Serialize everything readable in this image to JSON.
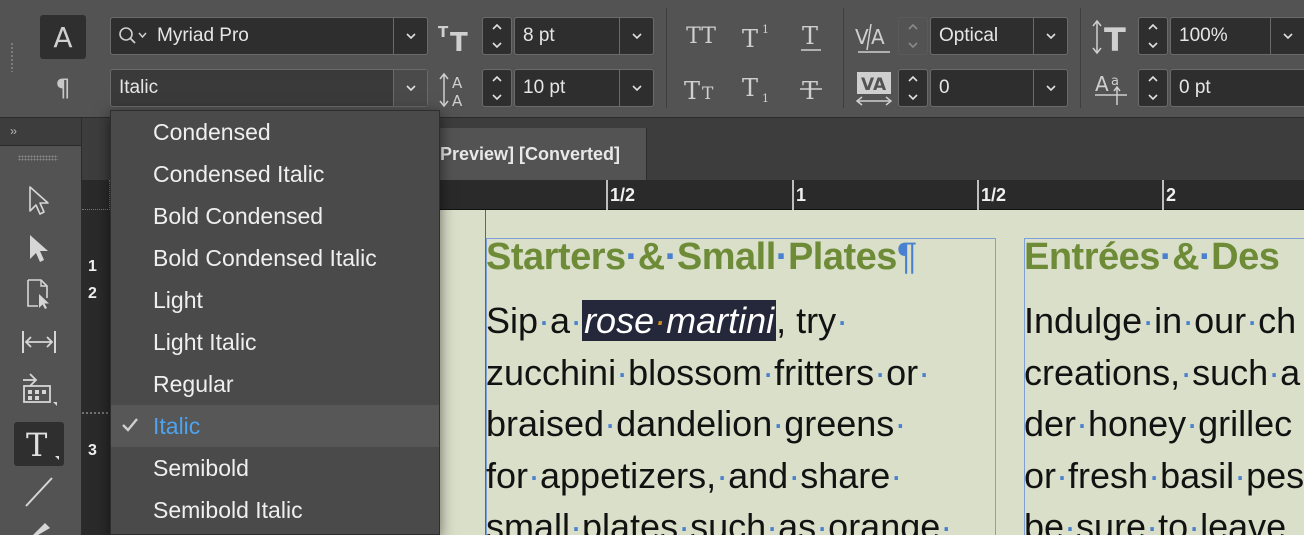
{
  "control_bar": {
    "character_mode_icon": "A",
    "paragraph_mode_icon": "¶",
    "font_family": "Myriad Pro",
    "font_style": "Italic",
    "font_size": "8 pt",
    "leading": "10 pt",
    "kerning": "Optical",
    "tracking": "0",
    "vertical_scale": "100%",
    "baseline_shift": "0 pt"
  },
  "tab": {
    "title": "Preview] [Converted]"
  },
  "ruler": {
    "h_labels": [
      "1/2",
      "1",
      "1/2",
      "2"
    ],
    "v_labels": [
      "1",
      "2",
      "3"
    ]
  },
  "font_style_menu": {
    "items": [
      "Condensed",
      "Condensed Italic",
      "Bold Condensed",
      "Bold Condensed Italic",
      "Light",
      "Light Italic",
      "Regular",
      "Italic",
      "Semibold",
      "Semibold Italic"
    ],
    "selected": "Italic"
  },
  "document": {
    "col1_heading": [
      "Starters",
      "&",
      "Small",
      "Plates"
    ],
    "col1_lines": [
      {
        "pre": "Sip",
        "mid": "a",
        "sel": [
          "rose",
          "martini"
        ],
        "post": ", try"
      },
      {
        "words": [
          "zucchini",
          "blossom",
          "fritters",
          "or"
        ]
      },
      {
        "words": [
          "braised",
          "dandelion",
          "greens"
        ]
      },
      {
        "words": [
          "for",
          "appetizers,",
          "and",
          "share"
        ]
      },
      {
        "words": [
          "small",
          "plates",
          "such",
          "as",
          "orange"
        ]
      }
    ],
    "col2_heading": [
      "Entrées",
      "&",
      "Des"
    ],
    "col2_lines": [
      {
        "words": [
          "Indulge",
          "in",
          "our",
          "ch"
        ]
      },
      {
        "words": [
          "creations,",
          "such",
          "a"
        ]
      },
      {
        "words": [
          "der",
          "honey",
          "grillec"
        ]
      },
      {
        "words": [
          "or",
          "fresh",
          "basil",
          "pes"
        ]
      },
      {
        "words": [
          "be",
          "sure",
          "to",
          "leave"
        ]
      }
    ]
  },
  "icons": [
    "search-icon",
    "chevron-down-icon",
    "font-size-icon",
    "leading-icon",
    "all-caps-icon",
    "superscript-icon",
    "underline-icon",
    "small-caps-icon",
    "subscript-icon",
    "strikethrough-icon",
    "kerning-icon",
    "tracking-icon",
    "vertical-scale-icon",
    "baseline-shift-icon",
    "selection-tool-icon",
    "direct-selection-tool-icon",
    "page-tool-icon",
    "gap-tool-icon",
    "content-collector-icon",
    "type-tool-icon",
    "line-tool-icon",
    "checkmark-icon"
  ],
  "colors": {
    "heading": "#6e8c38",
    "selection": "#25273a",
    "menu_selected_text": "#4ea3ee",
    "invisibles": "#4a80d0"
  }
}
